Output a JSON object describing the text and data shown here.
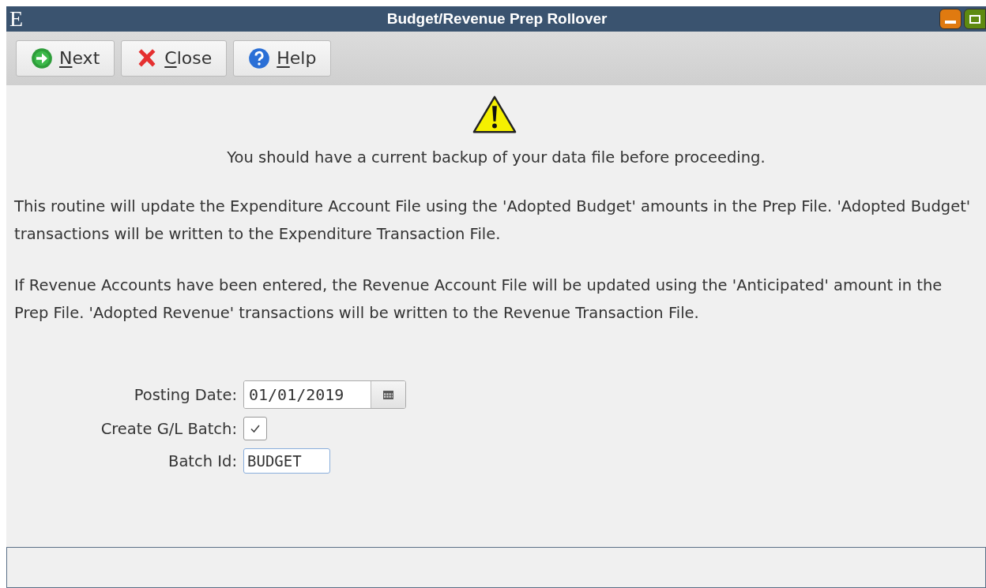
{
  "window": {
    "title": "Budget/Revenue Prep Rollover",
    "app_letter": "E"
  },
  "toolbar": [
    {
      "label": "Next",
      "kind": "next"
    },
    {
      "label": "Close",
      "kind": "close"
    },
    {
      "label": "Help",
      "kind": "help"
    }
  ],
  "warning": "You should have a current backup of your data file before proceeding.",
  "paragraphs": [
    "This routine will update the Expenditure Account File using the 'Adopted Budget' amounts in the Prep File.  'Adopted Budget' transactions will be written to the Expenditure Transaction File.",
    "If Revenue Accounts have been entered, the Revenue Account File will be updated using the 'Anticipated' amount in the Prep File.  'Adopted Revenue' transactions will be written to the Revenue Transaction File."
  ],
  "form": [
    {
      "label": "Posting Date:",
      "kind": "date",
      "value": "01/01/2019"
    },
    {
      "label": "Create G/L Batch:",
      "kind": "checkbox",
      "checked": true
    },
    {
      "label": "Batch Id:",
      "kind": "text",
      "value": "BUDGET"
    }
  ]
}
